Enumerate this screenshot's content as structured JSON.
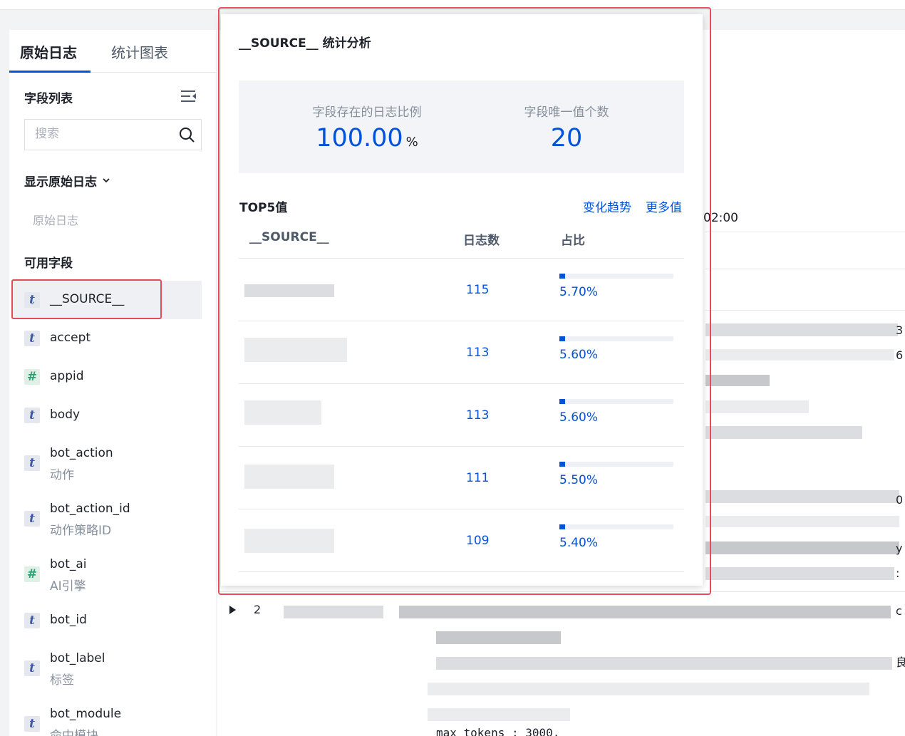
{
  "tabs": {
    "raw_logs": "原始日志",
    "stats_chart": "统计图表"
  },
  "field_list": {
    "title": "字段列表",
    "search_placeholder": "搜索",
    "show_raw_title": "显示原始日志",
    "raw_log_item": "原始日志",
    "available_title": "可用字段",
    "fields": [
      {
        "type": "t",
        "name": "__SOURCE__",
        "alias": ""
      },
      {
        "type": "t",
        "name": "accept",
        "alias": ""
      },
      {
        "type": "#",
        "name": "appid",
        "alias": ""
      },
      {
        "type": "t",
        "name": "body",
        "alias": ""
      },
      {
        "type": "t",
        "name": "bot_action",
        "alias": "动作"
      },
      {
        "type": "t",
        "name": "bot_action_id",
        "alias": "动作策略ID"
      },
      {
        "type": "#",
        "name": "bot_ai",
        "alias": "AI引擎"
      },
      {
        "type": "t",
        "name": "bot_id",
        "alias": ""
      },
      {
        "type": "t",
        "name": "bot_label",
        "alias": "标签"
      },
      {
        "type": "t",
        "name": "bot_module",
        "alias": "命中模块"
      }
    ]
  },
  "background": {
    "time_label": "02:00",
    "row_number": "2",
    "edge_chars": [
      "3",
      "6",
      "0",
      "y",
      ":",
      "c",
      "良"
    ],
    "code_snippet": "max_tokens : 3000,"
  },
  "popup": {
    "title": "__SOURCE__ 统计分析",
    "stat_ratio_label": "字段存在的日志比例",
    "stat_ratio_value": "100.00",
    "stat_ratio_unit": "%",
    "stat_unique_label": "字段唯一值个数",
    "stat_unique_value": "20",
    "top5_title": "TOP5值",
    "link_trend": "变化趋势",
    "link_more": "更多值",
    "col_source": "__SOURCE__",
    "col_count": "日志数",
    "col_ratio": "占比",
    "rows": [
      {
        "count": "115",
        "percent_label": "5.70%",
        "fraction": 0.057
      },
      {
        "count": "113",
        "percent_label": "5.60%",
        "fraction": 0.056
      },
      {
        "count": "113",
        "percent_label": "5.60%",
        "fraction": 0.056
      },
      {
        "count": "111",
        "percent_label": "5.50%",
        "fraction": 0.055
      },
      {
        "count": "109",
        "percent_label": "5.40%",
        "fraction": 0.054
      }
    ]
  },
  "colors": {
    "accent": "#0052d9",
    "highlight_border": "#e34d59"
  }
}
